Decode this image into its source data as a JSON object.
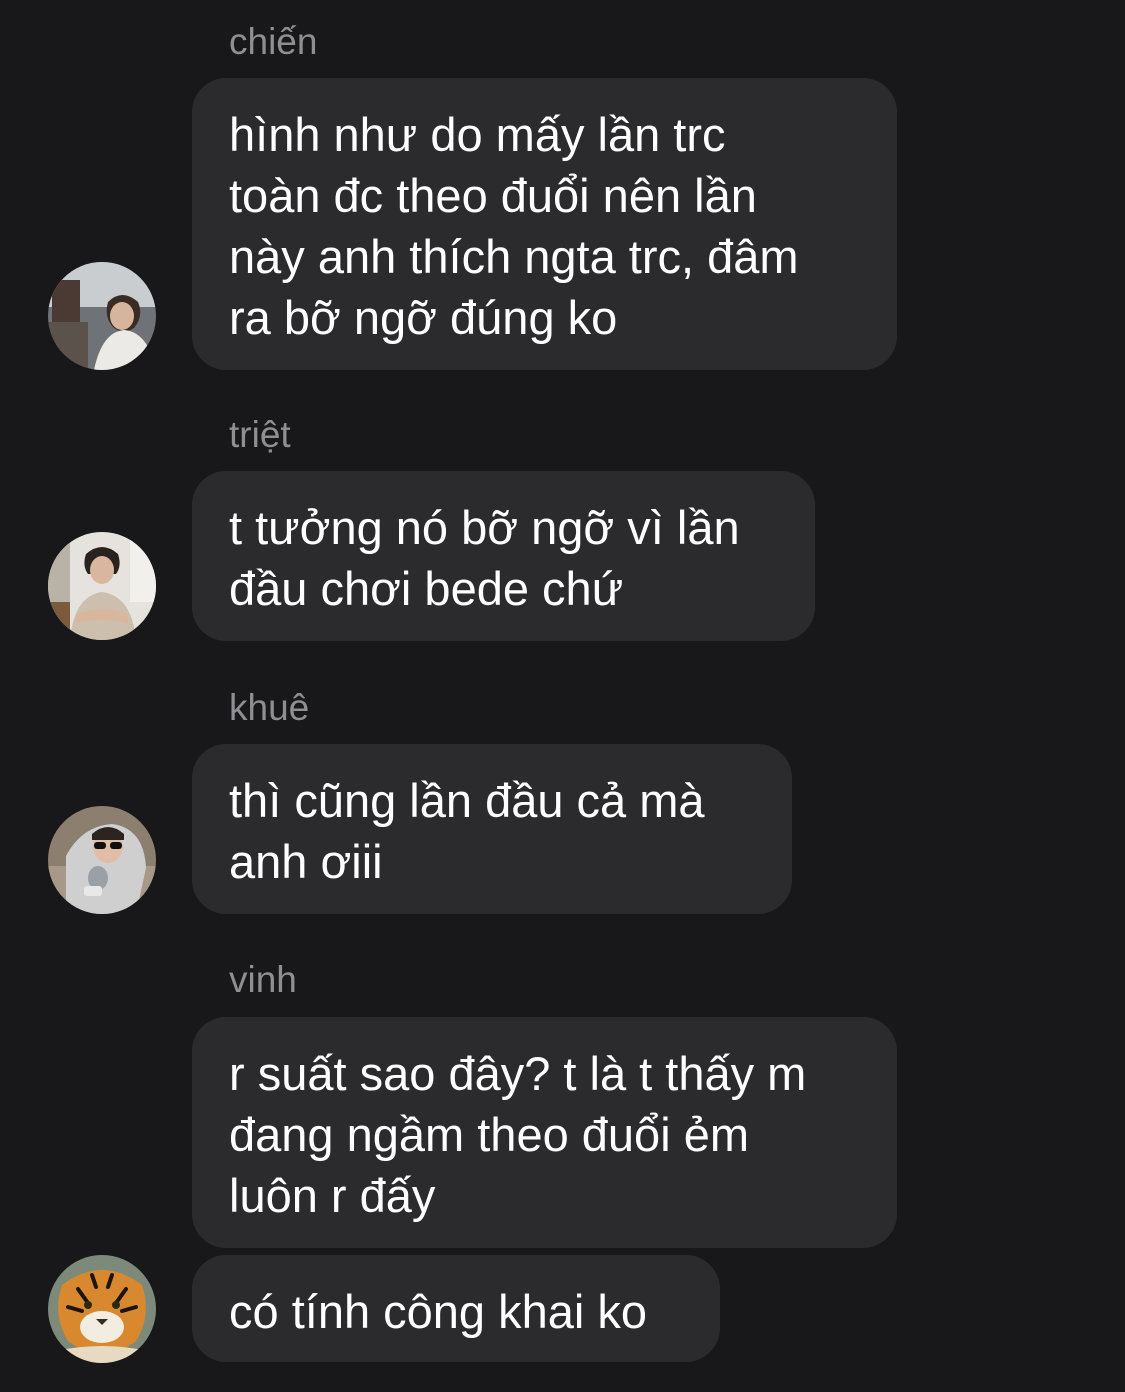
{
  "messages": [
    {
      "sender": "chiến",
      "text": "hình như do mấy lần trc\ntoàn đc theo đuổi nên lần\nnày anh thích ngta trc, đâm\nra bỡ ngỡ đúng ko",
      "avatar": "person-outdoor-photo"
    },
    {
      "sender": "triệt",
      "text": "t tưởng nó bỡ ngỡ vì lần\nđầu chơi bede chứ",
      "avatar": "person-arms-crossed-photo"
    },
    {
      "sender": "khuê",
      "text": "thì cũng lần đầu cả mà\nanh ơiii",
      "avatar": "person-sunglasses-photo"
    },
    {
      "sender": "vinh",
      "text": "r suất sao đây? t là t thấy m\nđang ngầm theo đuổi ẻm\nluôn r đấy"
    },
    {
      "text": "có tính công khai ko",
      "avatar": "tiger-photo"
    }
  ]
}
